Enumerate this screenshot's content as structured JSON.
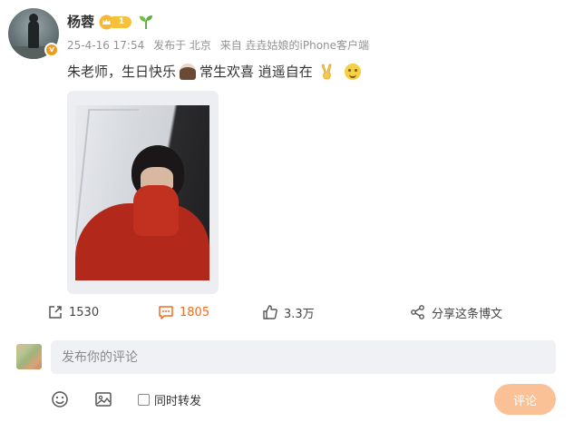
{
  "post": {
    "author": "杨蓉",
    "level_badge": "1",
    "timestamp": "25-4-16 17:54",
    "location": "发布于 北京",
    "source": "来自 垚垚姑娘的iPhone客户端",
    "text_segments": [
      "朱老师，生日快乐",
      "常生欢喜 逍遥自在"
    ],
    "emojis": [
      "cake-emoji",
      "victory-hand-emoji",
      "smile-emoji"
    ],
    "verified_mark": "v"
  },
  "actions": {
    "repost_count": "1530",
    "comment_count": "1805",
    "like_count": "3.3万",
    "share_label": "分享这条博文"
  },
  "composer": {
    "placeholder": "发布你的评论",
    "repost_label": "同时转发",
    "submit_label": "评论"
  },
  "colors": {
    "accent": "#f26b1f",
    "submit_button": "#fbc196",
    "input_bg": "#f0f1f4",
    "meta_text": "#939393"
  }
}
